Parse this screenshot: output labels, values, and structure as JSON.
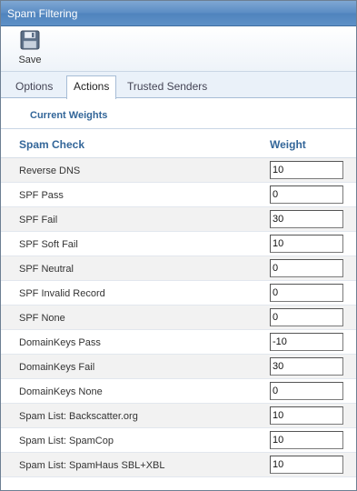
{
  "window": {
    "title": "Spam Filtering"
  },
  "toolbar": {
    "save_label": "Save"
  },
  "tabs": [
    {
      "label": "Options",
      "active": false
    },
    {
      "label": "Actions",
      "active": true
    },
    {
      "label": "Trusted Senders",
      "active": false
    }
  ],
  "section": {
    "title": "Current Weights"
  },
  "table": {
    "col_check": "Spam Check",
    "col_weight": "Weight",
    "rows": [
      {
        "name": "Reverse DNS",
        "weight": "10"
      },
      {
        "name": "SPF Pass",
        "weight": "0"
      },
      {
        "name": "SPF Fail",
        "weight": "30"
      },
      {
        "name": "SPF Soft Fail",
        "weight": "10"
      },
      {
        "name": "SPF Neutral",
        "weight": "0"
      },
      {
        "name": "SPF Invalid Record",
        "weight": "0"
      },
      {
        "name": "SPF None",
        "weight": "0"
      },
      {
        "name": "DomainKeys Pass",
        "weight": "-10"
      },
      {
        "name": "DomainKeys Fail",
        "weight": "30"
      },
      {
        "name": "DomainKeys None",
        "weight": "0"
      },
      {
        "name": "Spam List: Backscatter.org",
        "weight": "10"
      },
      {
        "name": "Spam List: SpamCop",
        "weight": "10"
      },
      {
        "name": "Spam List: SpamHaus SBL+XBL",
        "weight": "10"
      }
    ]
  },
  "colors": {
    "title_bar": "#5a8cc4",
    "heading_text": "#336699",
    "alt_row": "#f2f2f2"
  },
  "icons": {
    "save": "floppy-disk-icon"
  }
}
